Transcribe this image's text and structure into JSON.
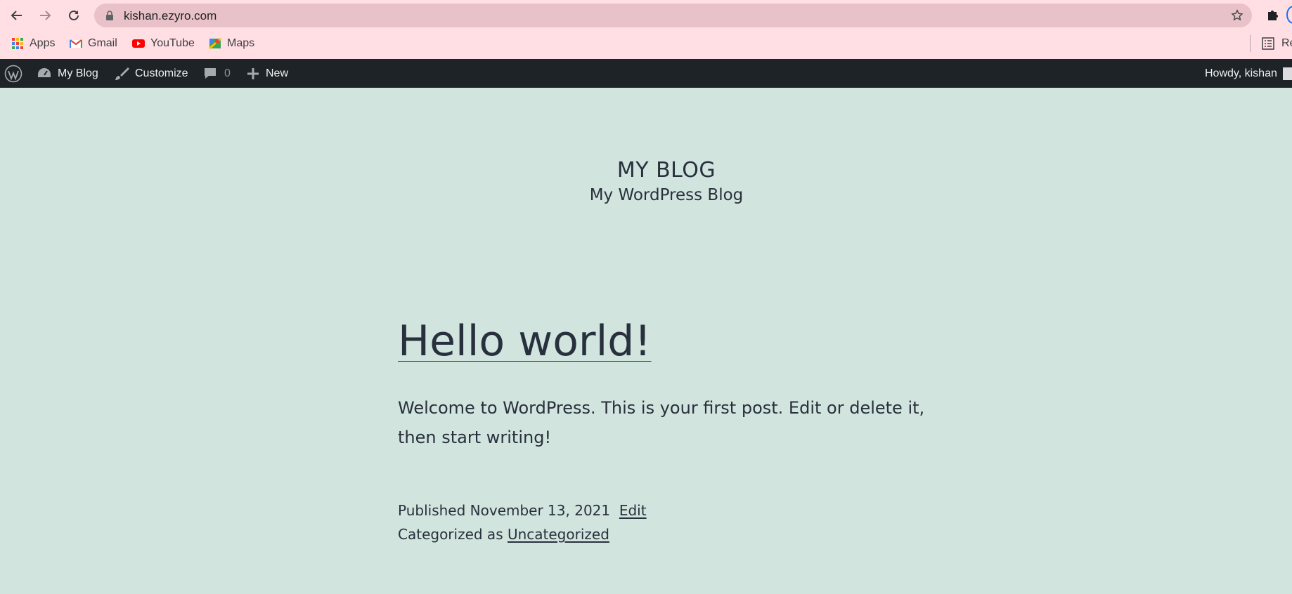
{
  "browser": {
    "url": "kishan.ezyro.com",
    "bookmarks": [
      {
        "label": "Apps",
        "icon": "apps-grid-icon"
      },
      {
        "label": "Gmail",
        "icon": "gmail-icon"
      },
      {
        "label": "YouTube",
        "icon": "youtube-icon"
      },
      {
        "label": "Maps",
        "icon": "maps-icon"
      }
    ],
    "reading_list_label": "Re"
  },
  "adminbar": {
    "site_label": "My Blog",
    "customize_label": "Customize",
    "comments_count": "0",
    "new_label": "New",
    "howdy": "Howdy, kishan"
  },
  "site": {
    "title": "MY BLOG",
    "tagline": "My WordPress Blog"
  },
  "post": {
    "title": "Hello world!",
    "excerpt": "Welcome to WordPress. This is your first post. Edit or delete it, then start writing!",
    "published_prefix": "Published",
    "published_date": "November 13, 2021",
    "edit_label": "Edit",
    "categorized_prefix": "Categorized as",
    "category": "Uncategorized"
  },
  "colors": {
    "chrome_bg": "#ffdfe4",
    "omnibox_bg": "#e8c2c8",
    "adminbar_bg": "#1d2327",
    "page_bg": "#d1e4dd",
    "text": "#28303d"
  }
}
